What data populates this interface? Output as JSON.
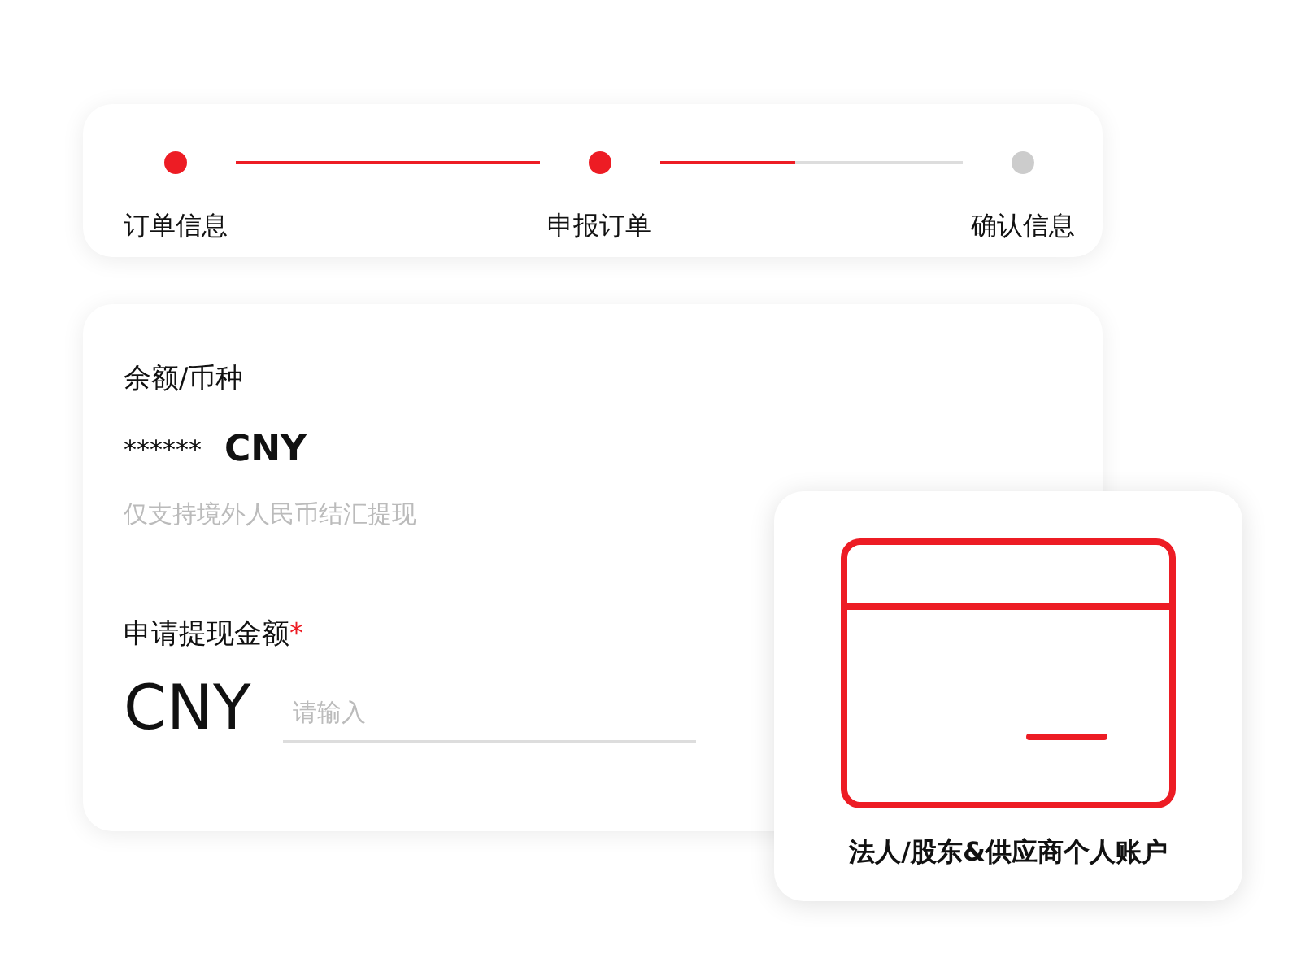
{
  "stepper": {
    "steps": [
      {
        "label": "订单信息",
        "done": true
      },
      {
        "label": "申报订单",
        "done": true
      },
      {
        "label": "确认信息",
        "done": false
      }
    ],
    "connectors": [
      {
        "kind": "complete"
      },
      {
        "kind": "partial",
        "level": 0.45
      }
    ]
  },
  "balance": {
    "label": "余额/币种",
    "masked_amount": "******",
    "currency": "CNY",
    "hint": "仅支持境外人民币结汇提现"
  },
  "withdraw": {
    "label": "申请提现金额",
    "required_mark": "*",
    "currency": "CNY",
    "placeholder": "请输入"
  },
  "account_card": {
    "label": "法人/股东&供应商个人账户"
  }
}
